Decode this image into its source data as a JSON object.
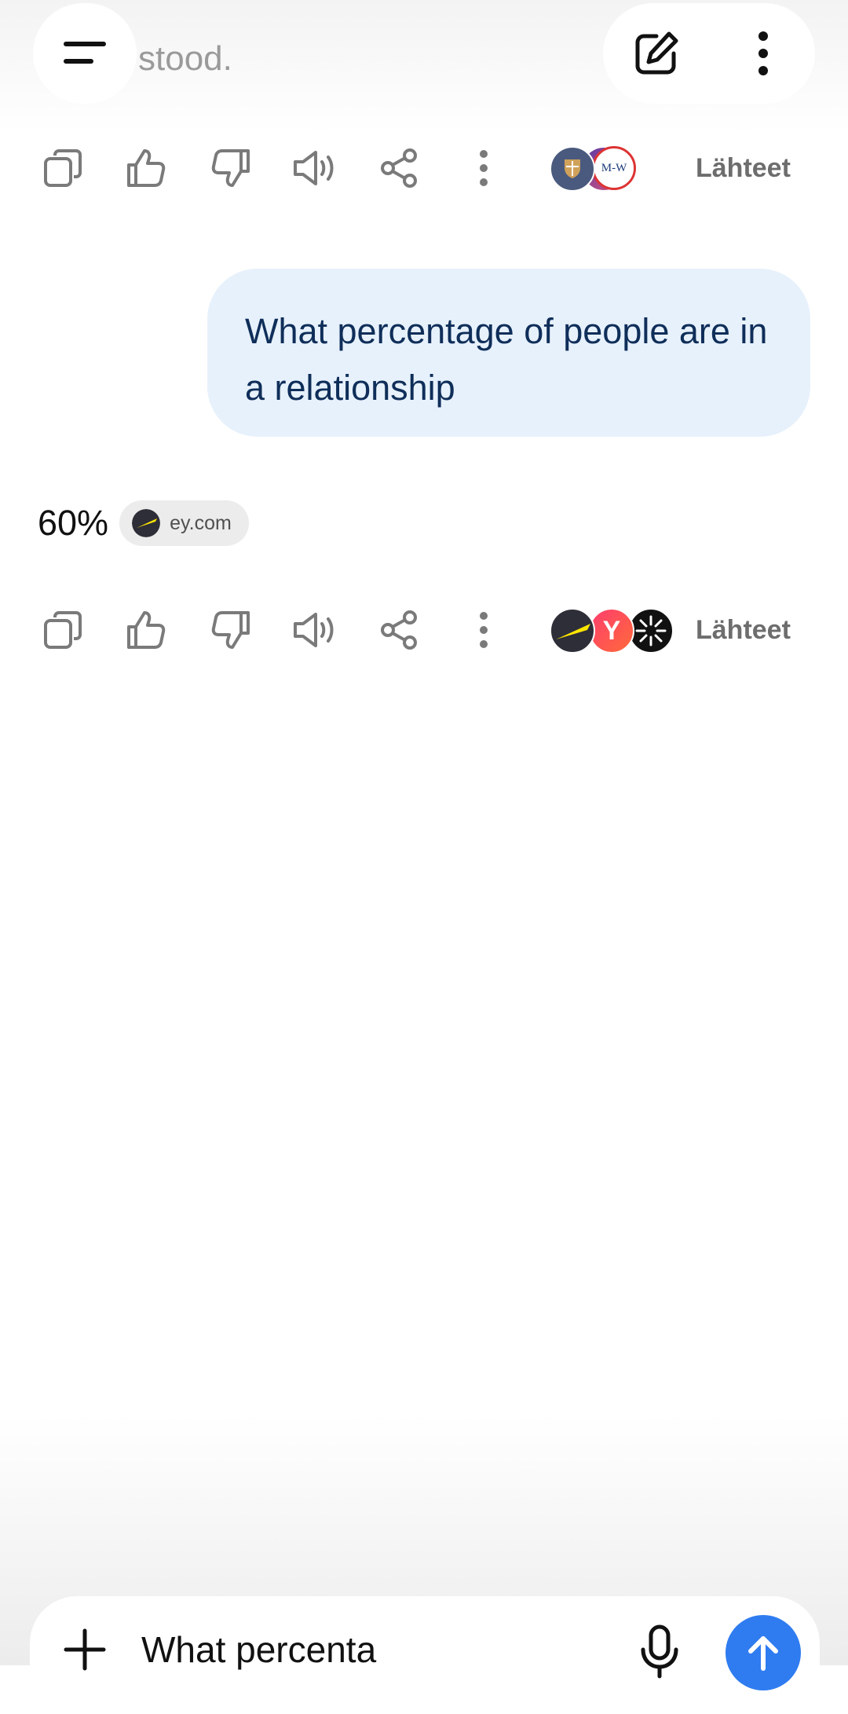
{
  "header": {
    "previous_text": "stood.",
    "menu_icon": "menu-icon",
    "new_chat_icon": "edit-icon",
    "more_icon": "more-vertical-icon"
  },
  "actions": {
    "copy_icon": "copy-icon",
    "like_icon": "thumbs-up-icon",
    "dislike_icon": "thumbs-down-icon",
    "read_aloud_icon": "speaker-icon",
    "share_icon": "share-icon",
    "more_icon": "more-vertical-icon"
  },
  "sources_label": "Lähteet",
  "first_response": {
    "sources": {
      "label": "Lähteet",
      "avatars": [
        "cambridge-logo",
        "merriam-webster-logo",
        "purple-gradient-logo"
      ],
      "mw_text": "M-W"
    }
  },
  "user_message": {
    "text": "What percentage of people are in a relationship"
  },
  "second_response": {
    "answer": "60%",
    "citation": "ey.com",
    "sources": {
      "label": "Lähteet",
      "avatars": [
        "ey-logo",
        "yougov-logo",
        "sunburst-logo"
      ],
      "y_letter": "Y"
    }
  },
  "composer": {
    "value": "What percenta",
    "add_icon": "plus-icon",
    "mic_icon": "microphone-icon",
    "send_icon": "arrow-up-icon"
  },
  "colors": {
    "bubble": "#e7f1fc",
    "bubble_text": "#0f2e59",
    "send": "#2f7cf0",
    "icon_gray": "#7a7a7a"
  }
}
